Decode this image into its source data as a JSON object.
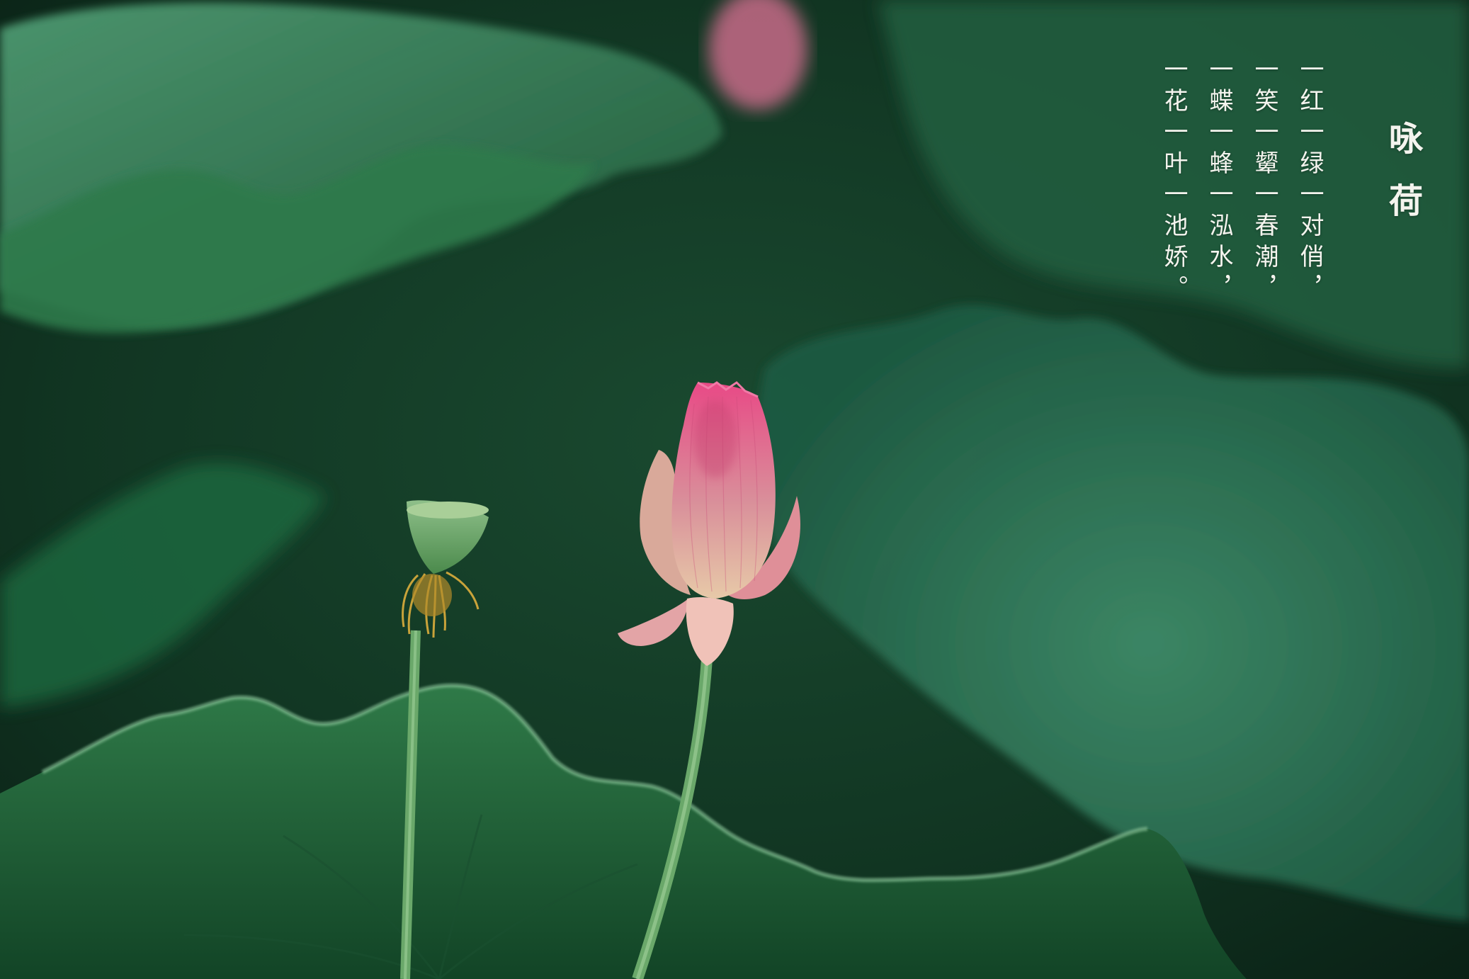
{
  "poem": {
    "title": "咏荷",
    "lines": [
      "一红一绿一对俏，",
      "一笑一颦一春潮，",
      "一蝶一蜂一泓水，",
      "一花一叶一池娇。"
    ]
  },
  "colors": {
    "background_green": "#0d2a1a",
    "leaf_green": "#2f7a52",
    "bud_pink": "#e0567f",
    "text": "#f4f4ee"
  }
}
